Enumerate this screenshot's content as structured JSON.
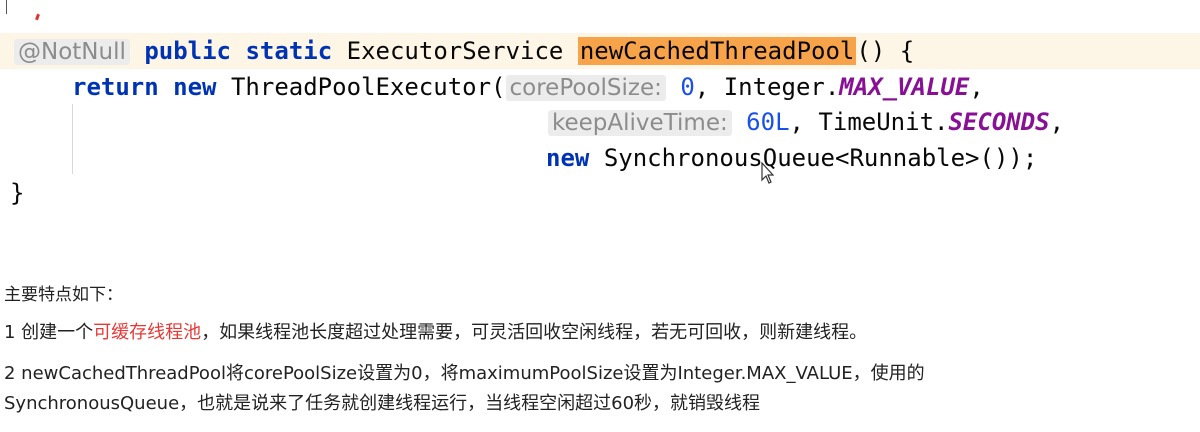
{
  "code": {
    "annotation": "@NotNull",
    "kw_public": "public",
    "kw_static": "static",
    "return_type": "ExecutorService",
    "method_name": "newCachedThreadPool",
    "signature_tail": "() {",
    "kw_return": "return",
    "kw_new": "new",
    "ctor_name": "ThreadPoolExecutor(",
    "hint_core": "corePoolSize:",
    "val_core": "0",
    "integer_prefix": ", Integer.",
    "const_max": "MAX_VALUE",
    "comma": ",",
    "hint_keep": "keepAliveTime:",
    "val_keep": "60L",
    "timeunit_prefix": ", TimeUnit.",
    "const_seconds": "SECONDS",
    "comma2": ",",
    "kw_new2": "new",
    "queue_expr": "SynchronousQueue<Runnable>());",
    "closing_brace": "}"
  },
  "notes": {
    "heading": "主要特点如下：",
    "item1_prefix": "1 创建一个",
    "item1_highlight": "可缓存线程池",
    "item1_suffix": "，如果线程池长度超过处理需要，可灵活回收空闲线程，若无可回收，则新建线程。",
    "item2_line1": "2 newCachedThreadPool将corePoolSize设置为0，将maximumPoolSize设置为Integer.MAX_VALUE，使用的",
    "item2_line2": "SynchronousQueue，也就是说来了任务就创建线程运行，当线程空闲超过60秒，就销毁线程"
  },
  "colors": {
    "keyword": "#0033b3",
    "constant": "#871094",
    "number": "#1750eb",
    "selection": "#f7a34a",
    "highlight_text": "#e53935"
  },
  "icons": {
    "cursor": "text-cursor-icon"
  }
}
